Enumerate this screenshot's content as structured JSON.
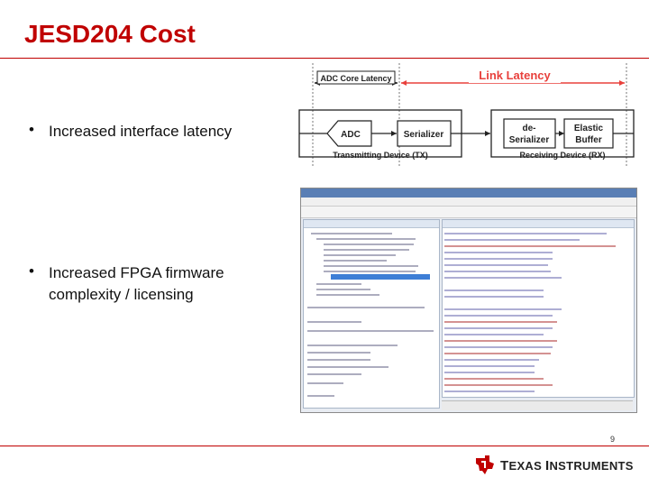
{
  "slide": {
    "title": "JESD204 Cost",
    "page_number": "9"
  },
  "bullets": [
    {
      "marker": "•",
      "lines": [
        "Increased interface latency"
      ]
    },
    {
      "marker": "•",
      "lines": [
        "Increased FPGA firmware",
        "complexity / licensing"
      ]
    }
  ],
  "diagram": {
    "adc_core_latency": "ADC Core Latency",
    "link_latency": "Link Latency",
    "blocks": {
      "adc": "ADC",
      "serializer": "Serializer",
      "deserializer_line1": "de-",
      "deserializer_line2": "Serializer",
      "elastic_line1": "Elastic",
      "elastic_line2": "Buffer"
    },
    "tx_label": "Transmitting Device (TX)",
    "rx_label": "Receiving Device (RX)",
    "colors": {
      "accent": "#e8403c",
      "box_border": "#222222",
      "box_fill": "#ffffff"
    }
  },
  "ide_screenshot": {
    "description_icon": "vivado-ide-screenshot"
  },
  "footer": {
    "logo_text_big_1": "T",
    "logo_text_small_1": "EXAS ",
    "logo_text_big_2": "I",
    "logo_text_small_2": "NSTRUMENTS",
    "logo_icon": "ti-texas-icon",
    "accent": "#c00000"
  }
}
